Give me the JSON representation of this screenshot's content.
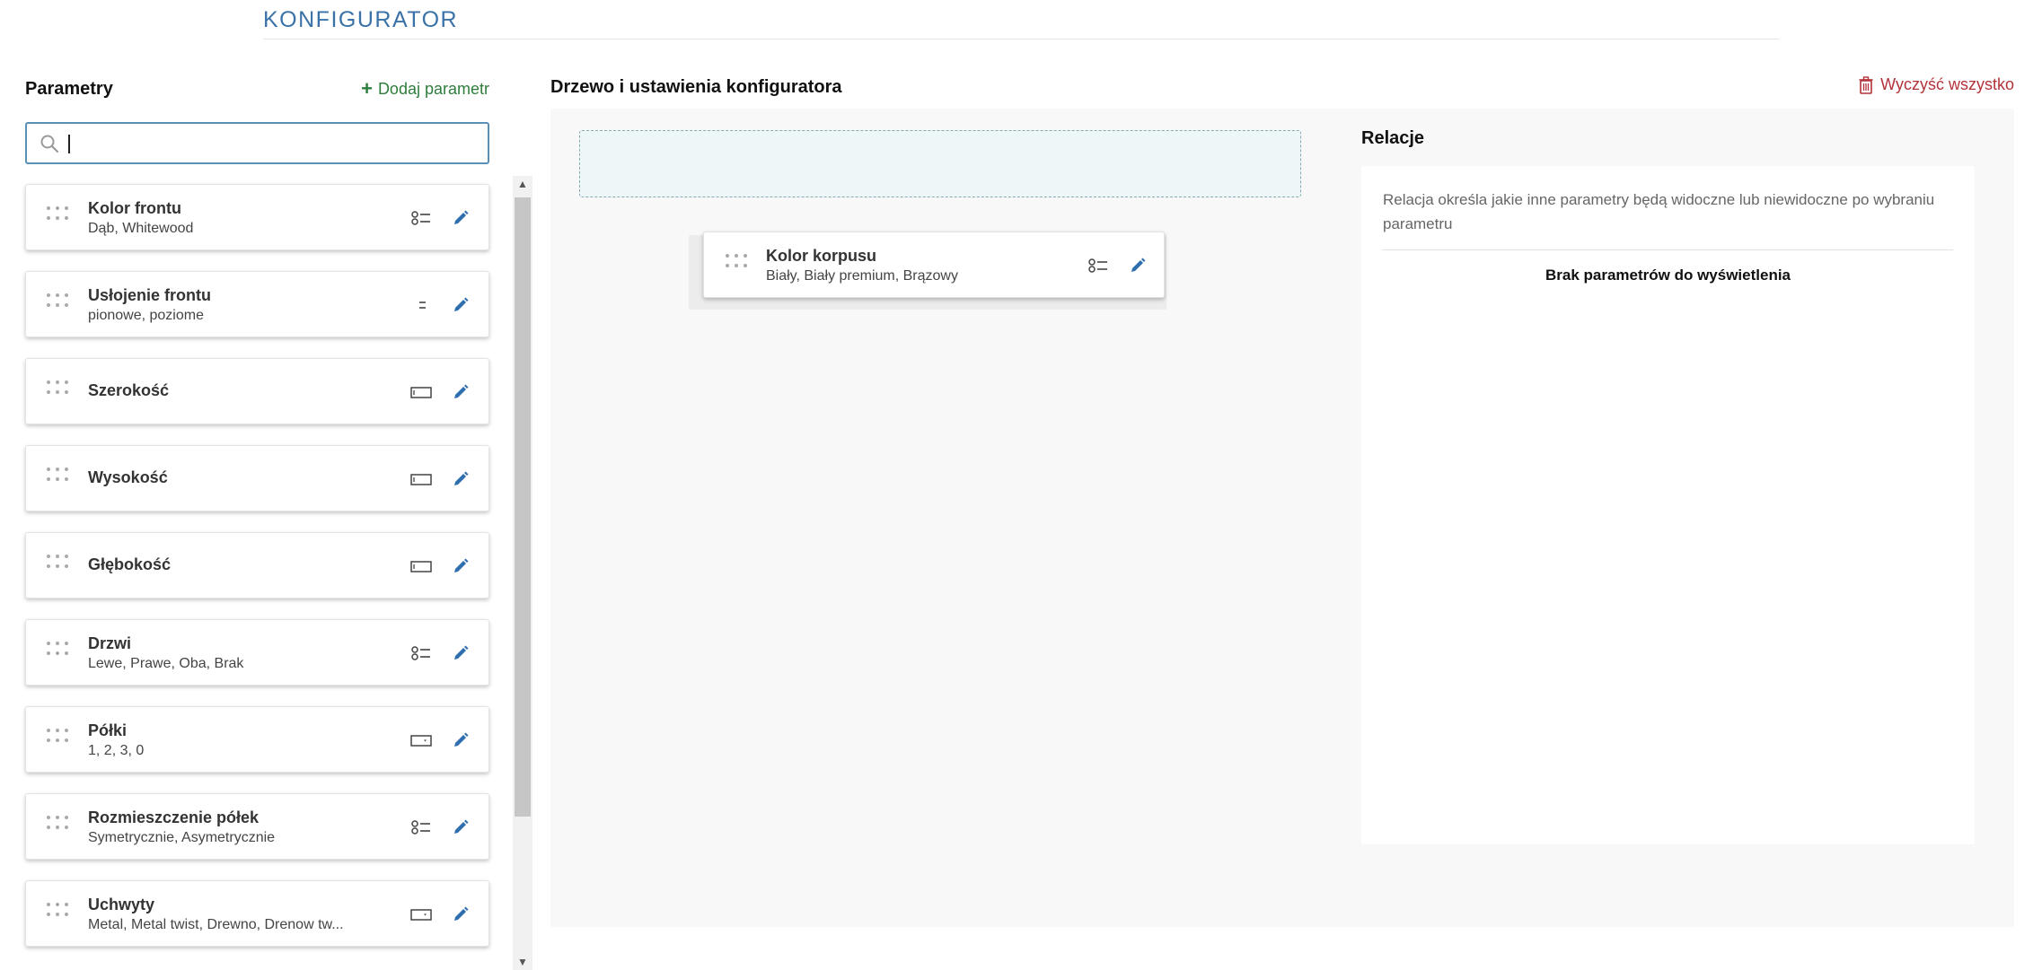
{
  "header": {
    "title": "KONFIGURATOR"
  },
  "parameters": {
    "title": "Parametry",
    "add_label": "Dodaj parametr",
    "search": {
      "value": "",
      "placeholder": ""
    },
    "items": [
      {
        "name": "Kolor frontu",
        "values": "Dąb, Whitewood",
        "type_icon": "list-icon"
      },
      {
        "name": "Usłojenie frontu",
        "values": "pionowe, poziome",
        "type_icon": "compact-list-icon"
      },
      {
        "name": "Szerokość",
        "values": "",
        "type_icon": "input-field-icon"
      },
      {
        "name": "Wysokość",
        "values": "",
        "type_icon": "input-field-icon"
      },
      {
        "name": "Głębokość",
        "values": "",
        "type_icon": "input-field-icon"
      },
      {
        "name": "Drzwi",
        "values": "Lewe, Prawe, Oba, Brak",
        "type_icon": "list-icon"
      },
      {
        "name": "Półki",
        "values": "1, 2, 3, 0",
        "type_icon": "dropdown-icon"
      },
      {
        "name": "Rozmieszczenie półek",
        "values": "Symetrycznie, Asymetrycznie",
        "type_icon": "list-icon"
      },
      {
        "name": "Uchwyty",
        "values": "Metal, Metal twist, Drewno, Drenow tw...",
        "type_icon": "dropdown-icon"
      }
    ]
  },
  "tree": {
    "title": "Drzewo i ustawienia konfiguratora",
    "clear_label": "Wyczyść wszystko",
    "node": {
      "name": "Kolor korpusu",
      "values": "Biały, Biały premium, Brązowy",
      "type_icon": "list-icon"
    }
  },
  "relations": {
    "title": "Relacje",
    "description": "Relacja określa jakie inne parametry będą widoczne lub niewidoczne po wybraniu parametru",
    "empty": "Brak parametrów do wyświetlenia"
  },
  "colors": {
    "title_blue": "#3a72a8",
    "add_green": "#2e7d3c",
    "edit_blue": "#2f6fb0",
    "clear_red": "#b3323a",
    "drop_zone": "#edf7f8"
  }
}
